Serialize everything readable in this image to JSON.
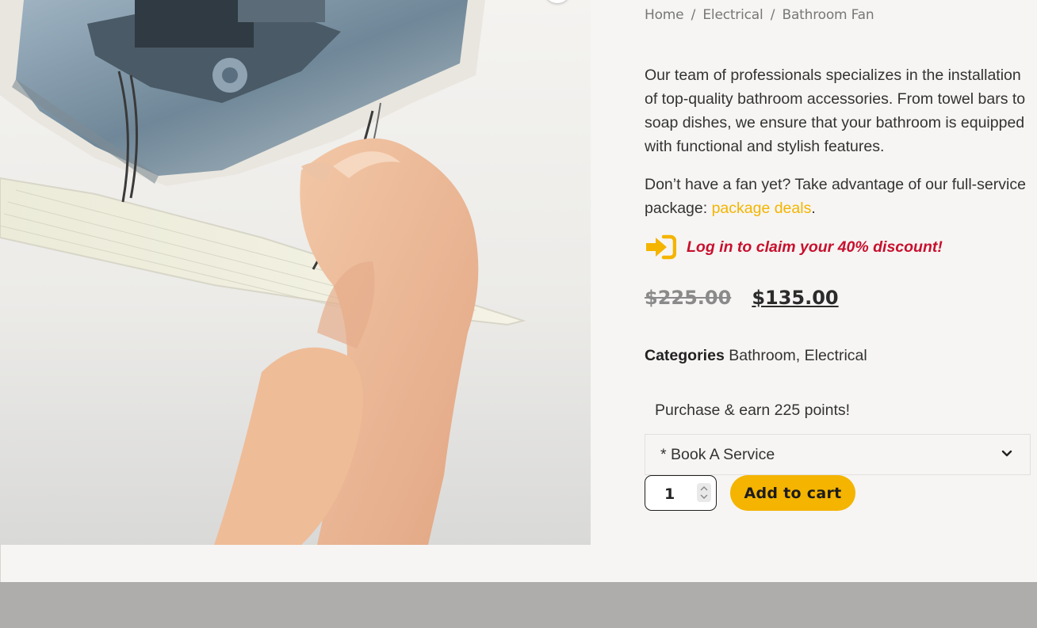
{
  "breadcrumb": {
    "items": [
      "Home",
      "Electrical",
      "Bathroom Fan"
    ],
    "separator": "/"
  },
  "description": {
    "paragraph1": "Our team of professionals specializes in the installation of top-quality bathroom accessories. From towel bars to soap dishes, we ensure that your bathroom is equipped with functional and stylish features.",
    "paragraph2_prefix": "Don’t have a fan yet? Take advantage of our full-service package: ",
    "paragraph2_link": "package deals",
    "paragraph2_suffix": "."
  },
  "login_prompt": {
    "icon": "sign-in-icon",
    "text": "Log in to claim your 40% discount!"
  },
  "price": {
    "regular": "$225.00",
    "sale": "$135.00"
  },
  "categories": {
    "label": "Categories",
    "items": [
      "Bathroom",
      "Electrical"
    ],
    "separator": ", "
  },
  "points_message": "Purchase & earn 225 points!",
  "service_select": {
    "selected": "* Book A Service",
    "icon": "chevron-down-icon"
  },
  "quantity": {
    "value": "1"
  },
  "add_to_cart_label": "Add to cart",
  "colors": {
    "accent": "#f4b400",
    "discount_text": "#c8102e",
    "page_background": "#f6f5f3",
    "footer_band": "#aeadac"
  }
}
